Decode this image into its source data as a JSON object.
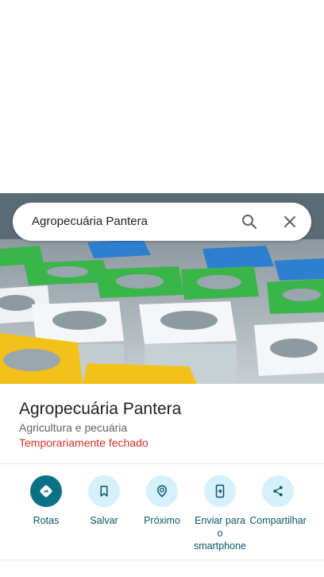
{
  "search": {
    "query": "Agropecuária Pantera"
  },
  "place": {
    "name": "Agropecuária Pantera",
    "category": "Agricultura e pecuária",
    "status": "Temporariamente fechado"
  },
  "actions": [
    {
      "label": "Rotas",
      "icon": "directions-icon"
    },
    {
      "label": "Salvar",
      "icon": "bookmark-icon"
    },
    {
      "label": "Próximo",
      "icon": "nearby-icon"
    },
    {
      "label": "Enviar para o smartphone",
      "icon": "send-to-phone-icon"
    },
    {
      "label": "Compartilhar",
      "icon": "share-icon"
    }
  ],
  "colors": {
    "primary": "#0b7285",
    "tint": "#d6f1fb",
    "closed": "#d93025"
  }
}
